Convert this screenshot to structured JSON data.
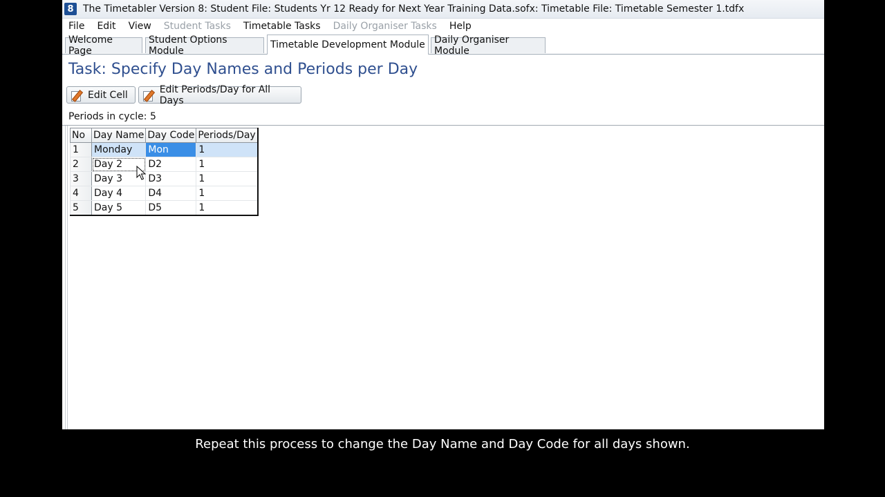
{
  "window": {
    "app_icon": "8",
    "title": "The Timetabler Version 8: Student File: Students Yr 12 Ready for Next Year Training Data.sofx: Timetable File: Timetable Semester 1.tdfx"
  },
  "menu": [
    {
      "label": "File",
      "disabled": false
    },
    {
      "label": "Edit",
      "disabled": false
    },
    {
      "label": "View",
      "disabled": false
    },
    {
      "label": "Student Tasks",
      "disabled": true
    },
    {
      "label": "Timetable Tasks",
      "disabled": false
    },
    {
      "label": "Daily Organiser Tasks",
      "disabled": true
    },
    {
      "label": "Help",
      "disabled": false
    }
  ],
  "tabs": [
    {
      "label": "Welcome Page",
      "active": false
    },
    {
      "label": "Student Options Module",
      "active": false
    },
    {
      "label": "Timetable Development Module",
      "active": true
    },
    {
      "label": "Daily Organiser Module",
      "active": false
    }
  ],
  "task": {
    "title": "Task: Specify Day Names and Periods per Day",
    "edit_cell_label": "Edit Cell",
    "edit_periods_label": "Edit Periods/Day for All Days",
    "cycle_label": "Periods in cycle: 5"
  },
  "grid": {
    "columns": [
      "No",
      "Day Name",
      "Day Code",
      "Periods/Day"
    ],
    "rows": [
      [
        "1",
        "Monday",
        "Mon",
        "1"
      ],
      [
        "2",
        "Day 2",
        "D2",
        "1"
      ],
      [
        "3",
        "Day 3",
        "D3",
        "1"
      ],
      [
        "4",
        "Day 4",
        "D4",
        "1"
      ],
      [
        "5",
        "Day 5",
        "D5",
        "1"
      ]
    ]
  },
  "caption": "Repeat this process to change the Day Name and Day Code for all days shown.",
  "colors": {
    "title_blue": "#2f4f8f",
    "selection": "#3a8ee6"
  }
}
